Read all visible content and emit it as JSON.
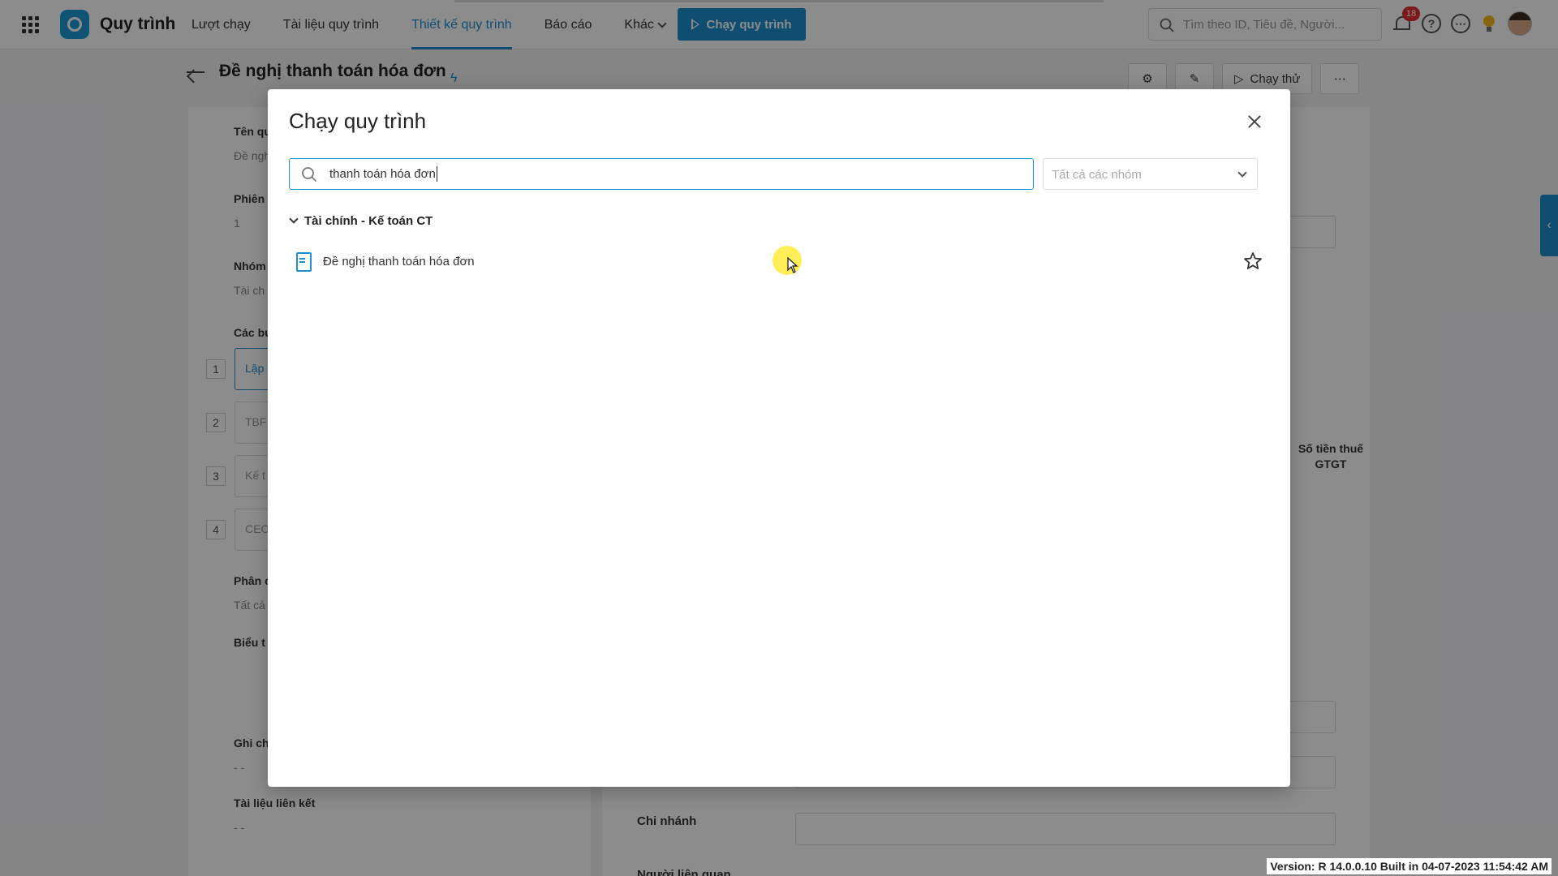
{
  "topbar": {
    "app_name": "Quy trình",
    "nav": [
      {
        "label": "Lượt chạy"
      },
      {
        "label": "Tài liệu quy trình"
      },
      {
        "label": "Thiết kế quy trình",
        "active": true
      },
      {
        "label": "Báo cáo"
      }
    ],
    "more_label": "Khác",
    "run_button": "Chạy quy trình",
    "search_placeholder": "Tìm theo ID, Tiêu đề, Người...",
    "notification_count": "18"
  },
  "page": {
    "title": "Đề nghị thanh toán hóa đơn",
    "test_run_button": "Chạy thử",
    "left_panel": {
      "labels": [
        "Tên qu",
        "Phiên",
        "Nhóm",
        "Các bư",
        "Phân c",
        "Biểu t",
        "Ghi ch",
        "Tài liệu liên kết"
      ],
      "values": [
        "Đề ngh",
        "1",
        "Tài ch",
        "Tất cả",
        "- -",
        "- -"
      ],
      "steps": [
        {
          "number": "1",
          "label": "Lập"
        },
        {
          "number": "2",
          "label": "TBF"
        },
        {
          "number": "3",
          "label": "Kế t"
        },
        {
          "number": "4",
          "label": "CEO"
        }
      ]
    },
    "right_panel": {
      "column_header": "Số tiền thuế GTGT",
      "branch_label": "Chi nhánh",
      "related_label": "Người liên quan"
    }
  },
  "modal": {
    "title": "Chạy quy trình",
    "search_value": "thanh toán hóa đơn",
    "group_placeholder": "Tất cả các nhóm",
    "group_name": "Tài chính - Kế toán CT",
    "processes": [
      {
        "name": "Đề nghị thanh toán hóa đơn"
      }
    ]
  },
  "footer": {
    "version": "Version: R 14.0.0.10 Built in 04-07-2023 11:54:42 AM"
  },
  "colors": {
    "accent": "#1c8fce",
    "badge": "#e02d2d",
    "cursor_highlight": "#ffeb3b"
  }
}
